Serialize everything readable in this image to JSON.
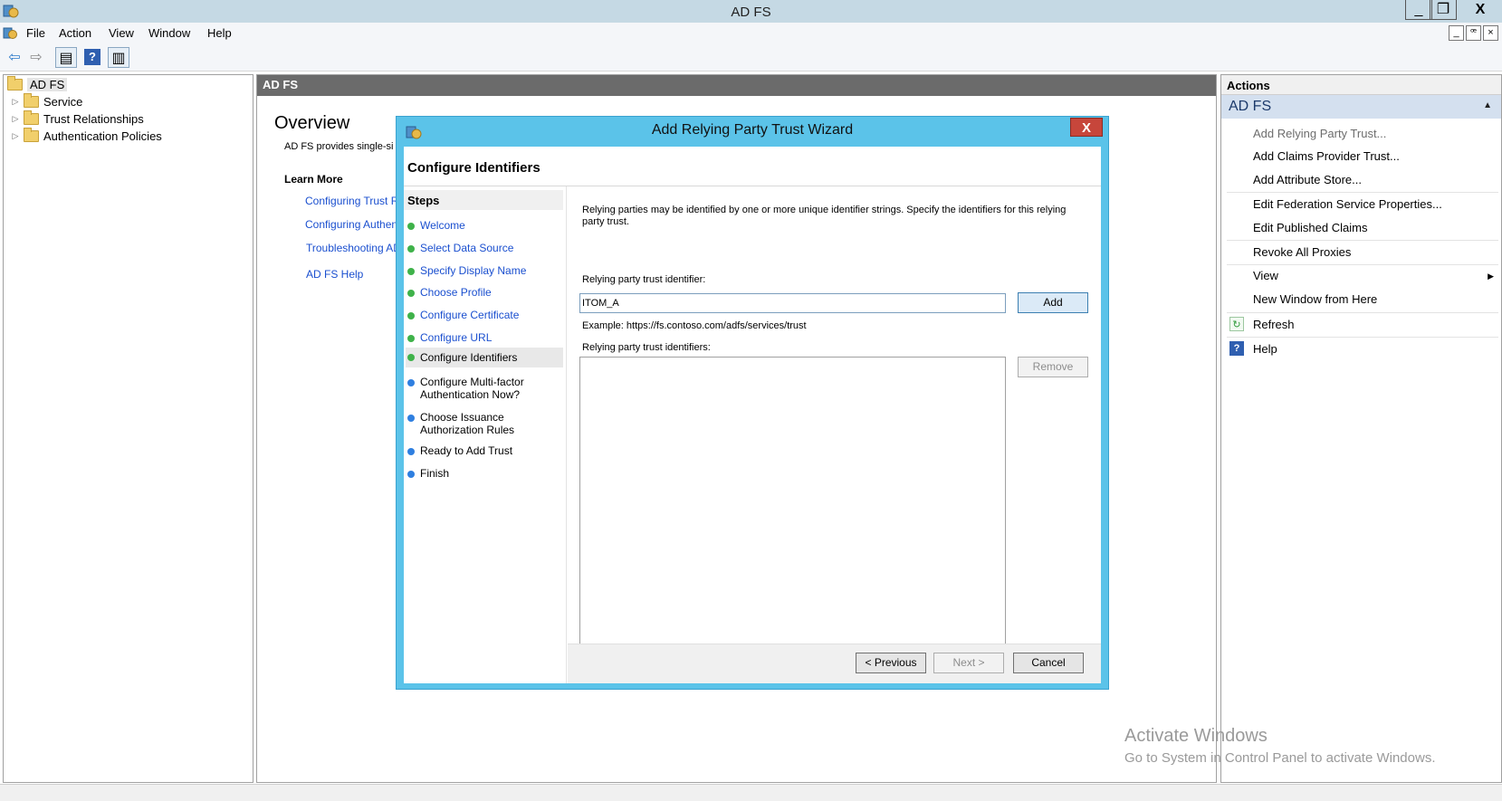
{
  "window": {
    "title": "AD FS",
    "minimize": "_",
    "maximize": "❐",
    "close": "X"
  },
  "menu": {
    "items": [
      "File",
      "Action",
      "View",
      "Window",
      "Help"
    ],
    "mdi_min": "_",
    "mdi_restore": "ꟹ",
    "mdi_close": "×"
  },
  "toolbar": {
    "back": "⇦",
    "forward": "⇨",
    "show_hide": "▤",
    "help": "?",
    "panel": "▥"
  },
  "tree": {
    "root": "AD FS",
    "children": [
      "Service",
      "Trust Relationships",
      "Authentication Policies"
    ],
    "expander": "▷"
  },
  "center": {
    "header": "AD FS",
    "overview_title": "Overview",
    "overview_desc": "AD FS provides single-si",
    "learn_more": "Learn More",
    "links": [
      "Configuring Trust R",
      "Configuring Authent",
      "Troubleshooting AD",
      "AD FS Help"
    ]
  },
  "watermark": {
    "line1": "Activate Windows",
    "line2": "Go to System in Control Panel to activate Windows."
  },
  "actions": {
    "header": "Actions",
    "section": "AD FS",
    "collapse": "▲",
    "submenu": "▶",
    "items": [
      "Add Relying Party Trust...",
      "Add Claims Provider Trust...",
      "Add Attribute Store...",
      "Edit Federation Service Properties...",
      "Edit Published Claims",
      "Revoke All Proxies",
      "View",
      "New Window from Here",
      "Refresh",
      "Help"
    ],
    "refresh_icon": "↻",
    "help_icon": "?"
  },
  "dialog": {
    "title": "Add Relying Party Trust Wizard",
    "close": "X",
    "heading": "Configure Identifiers",
    "steps_title": "Steps",
    "steps": [
      "Welcome",
      "Select Data Source",
      "Specify Display Name",
      "Choose Profile",
      "Configure Certificate",
      "Configure URL",
      "Configure Identifiers",
      "Configure Multi-factor Authentication Now?",
      "Choose Issuance Authorization Rules",
      "Ready to Add Trust",
      "Finish"
    ],
    "description": "Relying parties may be identified by one or more unique identifier strings. Specify the identifiers for this relying party trust.",
    "identifier_label": "Relying party trust identifier:",
    "identifier_value": "ITOM_A",
    "add_button": "Add",
    "example": "Example: https://fs.contoso.com/adfs/services/trust",
    "identifiers_label": "Relying party trust identifiers:",
    "remove_button": "Remove",
    "previous_button": "< Previous",
    "next_button": "Next >",
    "cancel_button": "Cancel"
  },
  "colors": {
    "dialog_frame": "#5bc3e9",
    "close_red": "#c7463b",
    "link_blue": "#1a4fcf",
    "done_green": "#3fb24a",
    "pending_blue": "#2f7fe0"
  }
}
